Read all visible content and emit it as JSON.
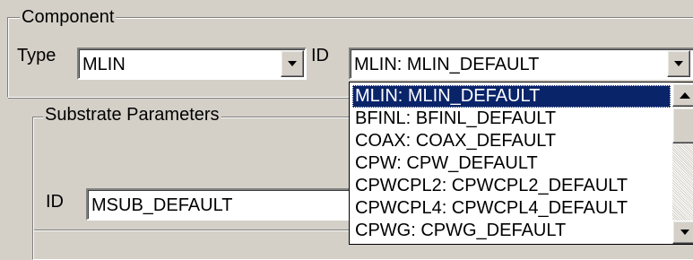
{
  "component": {
    "legend": "Component",
    "type_label": "Type",
    "type_value": "MLIN",
    "id_label": "ID",
    "id_value": "MLIN: MLIN_DEFAULT",
    "dropdown_items": [
      "MLIN: MLIN_DEFAULT",
      "BFINL: BFINL_DEFAULT",
      "COAX: COAX_DEFAULT",
      "CPW: CPW_DEFAULT",
      "CPWCPL2: CPWCPL2_DEFAULT",
      "CPWCPL4: CPWCPL4_DEFAULT",
      "CPWG: CPWG_DEFAULT"
    ],
    "selected_item": "MLIN: MLIN_DEFAULT"
  },
  "substrate": {
    "legend": "Substrate Parameters",
    "id_label": "ID",
    "id_value": "MSUB_DEFAULT"
  },
  "icons": {
    "dropdown": "chevron-down-icon",
    "scroll_up": "chevron-up-icon",
    "scroll_down": "chevron-down-icon"
  },
  "colors": {
    "face": "#d4d0c8",
    "selection": "#0a246a",
    "selection_text": "#ffffff"
  }
}
